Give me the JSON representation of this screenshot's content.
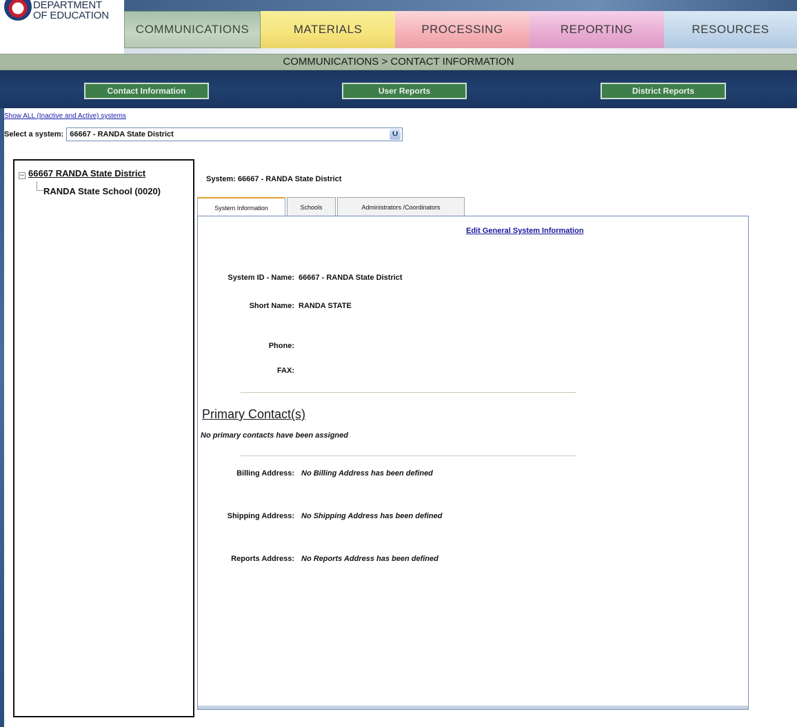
{
  "logo": {
    "line1": "DEPARTMENT",
    "line2": "OF EDUCATION"
  },
  "nav": {
    "tabs": [
      {
        "label": "COMMUNICATIONS"
      },
      {
        "label": "MATERIALS"
      },
      {
        "label": "PROCESSING"
      },
      {
        "label": "REPORTING"
      },
      {
        "label": "RESOURCES"
      }
    ]
  },
  "breadcrumb": "COMMUNICATIONS > CONTACT INFORMATION",
  "subnav": {
    "buttons": [
      {
        "label": "Contact Information"
      },
      {
        "label": "User Reports"
      },
      {
        "label": "District Reports"
      }
    ]
  },
  "system_select": {
    "show_all_link": "Show ALL (Inactive and Active) systems",
    "label": "Select a system:",
    "selected": "66667 - RANDA State District",
    "arrow_icon": "chevron-down-icon"
  },
  "tree": {
    "expander": "−",
    "root": "66667 RANDA State District",
    "child": "RANDA State School (0020)"
  },
  "main": {
    "system_title": "System:  66667 - RANDA State District",
    "tabs": [
      {
        "label": "System Information"
      },
      {
        "label": "Schools"
      },
      {
        "label": "Administrators /Coordinators"
      }
    ],
    "edit_link": "Edit General System Information",
    "fields": {
      "system_id_label": "System ID - Name:",
      "system_id_value": "66667   - RANDA State District",
      "short_name_label": "Short Name:",
      "short_name_value": "RANDA STATE",
      "phone_label": "Phone:",
      "fax_label": "FAX:"
    },
    "primary_contacts": {
      "heading": "Primary Contact(s)",
      "note": "No primary contacts have been assigned"
    },
    "addresses": {
      "billing_label": "Billing Address:",
      "billing_value": "No Billing Address has been defined",
      "shipping_label": "Shipping Address:",
      "shipping_value": "No Shipping Address has been defined",
      "reports_label": "Reports Address:",
      "reports_value": "No Reports Address has been defined"
    }
  },
  "colors": {
    "navy": "#1a3560",
    "breadcrumb_green": "#a8b9a2",
    "button_green": "#3e7e4b",
    "link_blue": "#1a1a9e",
    "tab_active_accent": "#e0a030"
  }
}
